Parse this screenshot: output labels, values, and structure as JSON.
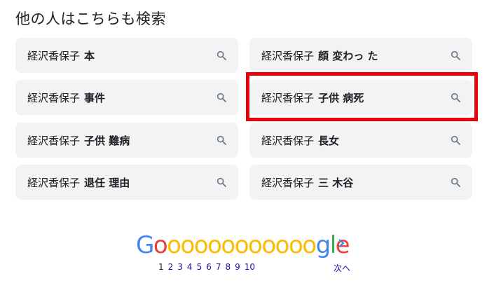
{
  "heading": "他の人はこちらも検索",
  "chips": [
    {
      "base": "経沢香保子",
      "bold": "本"
    },
    {
      "base": "経沢香保子",
      "bold": "顔 変わっ た"
    },
    {
      "base": "経沢香保子",
      "bold": "事件"
    },
    {
      "base": "経沢香保子",
      "bold": "子供 病死"
    },
    {
      "base": "経沢香保子",
      "bold": "子供 難病"
    },
    {
      "base": "経沢香保子",
      "bold": "長女"
    },
    {
      "base": "経沢香保子",
      "bold": "退任 理由"
    },
    {
      "base": "経沢香保子",
      "bold": "三 木谷"
    }
  ],
  "logo": {
    "letters": [
      "G",
      "o",
      "o",
      "o",
      "o",
      "o",
      "o",
      "o",
      "o",
      "o",
      "o",
      "o",
      "o",
      "g",
      "l",
      "e"
    ],
    "colors": [
      "#4285f4",
      "#ea4335",
      "#fbbc05",
      "#fbbc05",
      "#fbbc05",
      "#fbbc05",
      "#fbbc05",
      "#fbbc05",
      "#fbbc05",
      "#fbbc05",
      "#fbbc05",
      "#fbbc05",
      "#fbbc05",
      "#4285f4",
      "#34a853",
      "#ea4335"
    ]
  },
  "pagination": {
    "current": "1",
    "pages": [
      "2",
      "3",
      "4",
      "5",
      "6",
      "7",
      "8",
      "9",
      "10"
    ],
    "next_label": "次へ"
  },
  "icons": {
    "chip": "search-icon",
    "next": "chevron-right-icon"
  },
  "colors": {
    "chip_bg": "#f1f3f4",
    "highlight": "#e8000b",
    "link": "#1a0dab"
  }
}
